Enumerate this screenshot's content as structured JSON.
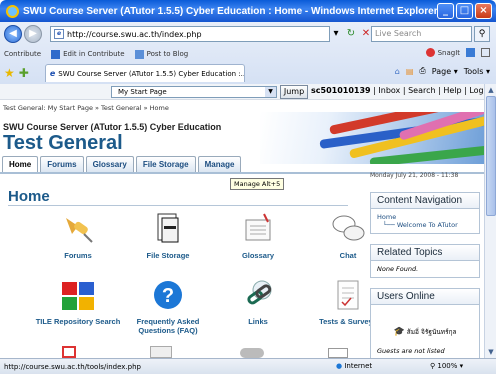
{
  "window": {
    "title": "SWU Course Server (ATutor 1.5.5) Cyber Education : Home - Windows Internet Explorer",
    "buttons": [
      "_",
      "□",
      "×"
    ]
  },
  "address_bar": {
    "url": "http://course.swu.ac.th/index.php",
    "search_placeholder": "Live Search"
  },
  "links_bar": {
    "items": [
      "Contribute",
      "Edit in Contribute",
      "Post to Blog"
    ],
    "snagit": "SnagIt"
  },
  "browser_tab": {
    "label": "SWU Course Server (ATutor 1.5.5) Cyber Education :..."
  },
  "command_bar": {
    "page": "Page",
    "tools": "Tools"
  },
  "page": {
    "jump_select": "My Start Page",
    "jump_button": "Jump",
    "user": "sc501010139",
    "user_links": " | Inbox | Search | Help | Log-out",
    "breadcrumb": "Test General: My Start Page » Test General » Home",
    "site_name": "SWU Course Server (ATutor 1.5.5) Cyber Education",
    "course_title": "Test General",
    "course_tabs": [
      "Home",
      "Forums",
      "Glossary",
      "File Storage",
      "Manage"
    ],
    "tooltip": "Manage Alt+5",
    "date": "Monday July 21, 2008 - 11:38",
    "home_heading": "Home",
    "tools": [
      {
        "label": "Forums",
        "icon": "pushpin-icon"
      },
      {
        "label": "File Storage",
        "icon": "file-cabinet-icon"
      },
      {
        "label": "Glossary",
        "icon": "notebook-icon"
      },
      {
        "label": "Chat",
        "icon": "chat-bubbles-icon"
      },
      {
        "label": "TILE Repository Search",
        "icon": "puzzle-icon"
      },
      {
        "label": "Frequently Asked Questions (FAQ)",
        "icon": "question-mark-icon"
      },
      {
        "label": "Links",
        "icon": "chain-link-icon"
      },
      {
        "label": "Tests & Surveys",
        "icon": "checklist-icon"
      }
    ],
    "sidebar": {
      "content_navigation": {
        "heading": "Content Navigation",
        "root": "Home",
        "child": "Welcome To ATutor"
      },
      "related_topics": {
        "heading": "Related Topics",
        "text": "None Found."
      },
      "users_online": {
        "heading": "Users Online",
        "user": "ส้มอิ่ จิรัฐนันทร์กุล",
        "note": "Guests are not listed"
      }
    }
  },
  "status_bar": {
    "url": "http://course.swu.ac.th/tools/index.php",
    "zone": "Internet",
    "zoom": "100%"
  }
}
